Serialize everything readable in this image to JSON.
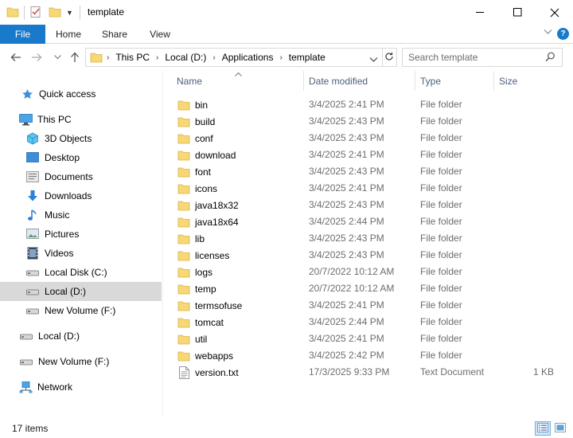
{
  "window": {
    "title": "template",
    "minimize_glyph": "—",
    "maximize_glyph": "☐",
    "close_glyph": "✕"
  },
  "ribbon": {
    "tabs": [
      {
        "label": "File"
      },
      {
        "label": "Home"
      },
      {
        "label": "Share"
      },
      {
        "label": "View"
      }
    ],
    "help_label": "?"
  },
  "address": {
    "crumbs": [
      "This PC",
      "Local (D:)",
      "Applications",
      "template"
    ]
  },
  "search": {
    "placeholder": "Search template"
  },
  "sidebar": {
    "items": [
      {
        "label": "Quick access",
        "icon": "star-icon"
      },
      {
        "label": "This PC",
        "icon": "computer-icon"
      },
      {
        "label": "3D Objects",
        "icon": "cube-icon"
      },
      {
        "label": "Desktop",
        "icon": "desktop-icon"
      },
      {
        "label": "Documents",
        "icon": "documents-icon"
      },
      {
        "label": "Downloads",
        "icon": "download-arrow-icon"
      },
      {
        "label": "Music",
        "icon": "music-note-icon"
      },
      {
        "label": "Pictures",
        "icon": "pictures-icon"
      },
      {
        "label": "Videos",
        "icon": "film-icon"
      },
      {
        "label": "Local Disk (C:)",
        "icon": "drive-icon"
      },
      {
        "label": "Local (D:)",
        "icon": "drive-icon"
      },
      {
        "label": "New Volume (F:)",
        "icon": "drive-icon"
      },
      {
        "label": "Local (D:)",
        "icon": "drive-icon"
      },
      {
        "label": "New Volume (F:)",
        "icon": "drive-icon"
      },
      {
        "label": "Network",
        "icon": "network-icon"
      }
    ],
    "selected_index": 10
  },
  "columns": {
    "name": "Name",
    "date": "Date modified",
    "type": "Type",
    "size": "Size"
  },
  "files": [
    {
      "name": "bin",
      "date": "3/4/2025 2:41 PM",
      "type": "File folder",
      "size": "",
      "icon": "folder-icon"
    },
    {
      "name": "build",
      "date": "3/4/2025 2:43 PM",
      "type": "File folder",
      "size": "",
      "icon": "folder-icon"
    },
    {
      "name": "conf",
      "date": "3/4/2025 2:43 PM",
      "type": "File folder",
      "size": "",
      "icon": "folder-icon"
    },
    {
      "name": "download",
      "date": "3/4/2025 2:41 PM",
      "type": "File folder",
      "size": "",
      "icon": "folder-icon"
    },
    {
      "name": "font",
      "date": "3/4/2025 2:43 PM",
      "type": "File folder",
      "size": "",
      "icon": "folder-icon"
    },
    {
      "name": "icons",
      "date": "3/4/2025 2:41 PM",
      "type": "File folder",
      "size": "",
      "icon": "folder-icon"
    },
    {
      "name": "java18x32",
      "date": "3/4/2025 2:43 PM",
      "type": "File folder",
      "size": "",
      "icon": "folder-icon"
    },
    {
      "name": "java18x64",
      "date": "3/4/2025 2:44 PM",
      "type": "File folder",
      "size": "",
      "icon": "folder-icon"
    },
    {
      "name": "lib",
      "date": "3/4/2025 2:43 PM",
      "type": "File folder",
      "size": "",
      "icon": "folder-icon"
    },
    {
      "name": "licenses",
      "date": "3/4/2025 2:43 PM",
      "type": "File folder",
      "size": "",
      "icon": "folder-icon"
    },
    {
      "name": "logs",
      "date": "20/7/2022 10:12 AM",
      "type": "File folder",
      "size": "",
      "icon": "folder-icon"
    },
    {
      "name": "temp",
      "date": "20/7/2022 10:12 AM",
      "type": "File folder",
      "size": "",
      "icon": "folder-icon"
    },
    {
      "name": "termsofuse",
      "date": "3/4/2025 2:41 PM",
      "type": "File folder",
      "size": "",
      "icon": "folder-icon"
    },
    {
      "name": "tomcat",
      "date": "3/4/2025 2:44 PM",
      "type": "File folder",
      "size": "",
      "icon": "folder-icon"
    },
    {
      "name": "util",
      "date": "3/4/2025 2:41 PM",
      "type": "File folder",
      "size": "",
      "icon": "folder-icon"
    },
    {
      "name": "webapps",
      "date": "3/4/2025 2:42 PM",
      "type": "File folder",
      "size": "",
      "icon": "folder-icon"
    },
    {
      "name": "version.txt",
      "date": "17/3/2025 9:33 PM",
      "type": "Text Document",
      "size": "1 KB",
      "icon": "text-file-icon"
    }
  ],
  "status": {
    "item_count": "17 items"
  },
  "colors": {
    "accent": "#1979ca",
    "folder": "#f8d775",
    "selected_grey": "#d9d9d9"
  }
}
